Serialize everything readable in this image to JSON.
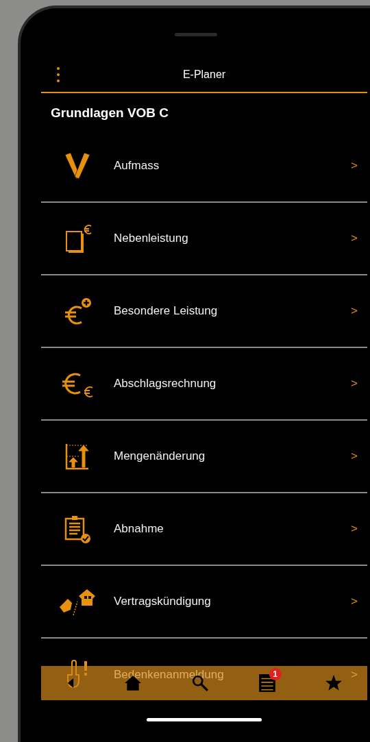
{
  "header": {
    "title": "E-Planer"
  },
  "section_title": "Grundlagen VOB C",
  "items": [
    {
      "kind": "ruler",
      "label": "Aufmass",
      "chevron": ">"
    },
    {
      "kind": "document-euro",
      "label": "Nebenleistung",
      "chevron": ">"
    },
    {
      "kind": "euro-plus",
      "label": "Besondere Leistung",
      "chevron": ">"
    },
    {
      "kind": "euro-euro",
      "label": "Abschlagsrechnung",
      "chevron": ">"
    },
    {
      "kind": "quantity",
      "label": "Mengenänderung",
      "chevron": ">"
    },
    {
      "kind": "clipboard",
      "label": "Abnahme",
      "chevron": ">"
    },
    {
      "kind": "kick-house",
      "label": "Vertragskündigung",
      "chevron": ">"
    },
    {
      "kind": "hand-warning",
      "label": "Bedenkenanmeldung",
      "chevron": ">"
    }
  ],
  "tab_bar": [
    {
      "kind": "back"
    },
    {
      "kind": "home"
    },
    {
      "kind": "search"
    },
    {
      "kind": "list",
      "badge": "1"
    },
    {
      "kind": "star"
    }
  ]
}
